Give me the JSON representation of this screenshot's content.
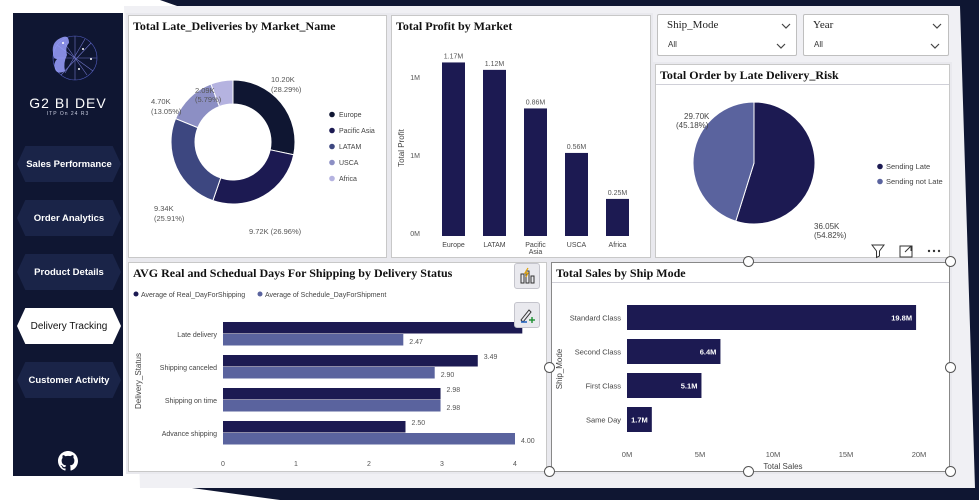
{
  "brand": {
    "name": "G2 BI DEV",
    "tagline": "ITP On 24 R3"
  },
  "nav": {
    "sales": "Sales Performance",
    "orders": "Order Analytics",
    "products": "Product Details",
    "delivery": "Delivery Tracking",
    "customers": "Customer Activity"
  },
  "slicers": {
    "ship_mode": {
      "label": "Ship_Mode",
      "value": "All"
    },
    "year": {
      "label": "Year",
      "value": "All"
    }
  },
  "colors": {
    "navy": "#0f1632",
    "series_dark": "#1c1a52",
    "series_mid": "#3d4780",
    "series_light": "#5a639e",
    "series_lighter": "#8c8fc4",
    "series_lightest": "#b5b3e0"
  },
  "chart_data": [
    {
      "id": "late_deliveries",
      "type": "pie",
      "title": "Total Late_Deliveries by Market_Name",
      "donut": true,
      "legend_position": "right",
      "slices": [
        {
          "name": "Europe",
          "value": 10200,
          "label": "10.20K",
          "pct": "(28.29%)"
        },
        {
          "name": "Pacific Asia",
          "value": 9720,
          "label": "9.72K (26.96%)",
          "pct": ""
        },
        {
          "name": "LATAM",
          "value": 9340,
          "label": "9.34K",
          "pct": "(25.91%)"
        },
        {
          "name": "USCA",
          "value": 4700,
          "label": "4.70K",
          "pct": "(13.05%)"
        },
        {
          "name": "Africa",
          "value": 2090,
          "label": "2.09K",
          "pct": "(5.79%)"
        }
      ]
    },
    {
      "id": "profit_by_market",
      "type": "bar",
      "title": "Total Profit by Market",
      "ylabel": "Total Profit",
      "ylim": [
        0,
        1200000
      ],
      "yticks": [
        "0M",
        "1M",
        "1M"
      ],
      "categories": [
        "Europe",
        "LATAM",
        "Pacific Asia",
        "USCA",
        "Africa"
      ],
      "values": [
        1170000,
        1120000,
        860000,
        560000,
        250000
      ],
      "labels": [
        "1.17M",
        "1.12M",
        "0.86M",
        "0.56M",
        "0.25M"
      ]
    },
    {
      "id": "order_late_risk",
      "type": "pie",
      "title": "Total Order by Late Delivery_Risk",
      "legend_position": "right",
      "slices": [
        {
          "name": "Sending Late",
          "value": 36050,
          "label": "36.05K",
          "pct": "(54.82%)"
        },
        {
          "name": "Sending not Late",
          "value": 29700,
          "label": "29.70K",
          "pct": "(45.18%)"
        }
      ]
    },
    {
      "id": "shipping_days",
      "type": "bar",
      "orientation": "horizontal",
      "title": "AVG Real and Schedual Days For Shipping by Delivery Status",
      "ylabel": "Delivery_Status",
      "xlim": [
        0,
        4
      ],
      "xticks": [
        "0",
        "1",
        "2",
        "3",
        "4"
      ],
      "categories": [
        "Late delivery",
        "Shipping canceled",
        "Shipping on time",
        "Advance shipping"
      ],
      "series": [
        {
          "name": "Average of Real_DayForShipping",
          "values": [
            4.1,
            3.49,
            2.98,
            2.5
          ],
          "labels": [
            "",
            "3.49",
            "2.98",
            "2.50"
          ]
        },
        {
          "name": "Average of Schedule_DayForShipment",
          "values": [
            2.47,
            2.9,
            2.98,
            4.0
          ],
          "labels": [
            "2.47",
            "2.90",
            "2.98",
            "4.00"
          ]
        }
      ]
    },
    {
      "id": "sales_by_ship_mode",
      "type": "bar",
      "orientation": "horizontal",
      "title": "Total Sales by Ship Mode",
      "xlabel": "Total Sales",
      "ylabel": "Ship_Mode",
      "xlim": [
        0,
        20000000
      ],
      "xticks": [
        "0M",
        "5M",
        "10M",
        "15M",
        "20M"
      ],
      "categories": [
        "Standard Class",
        "Second Class",
        "First Class",
        "Same Day"
      ],
      "values": [
        19800000,
        6400000,
        5100000,
        1700000
      ],
      "labels": [
        "19.8M",
        "6.4M",
        "5.1M",
        "1.7M"
      ]
    }
  ]
}
